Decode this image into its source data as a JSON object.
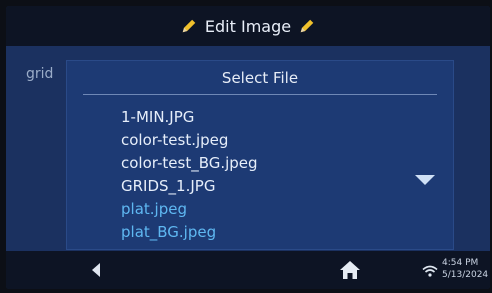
{
  "header": {
    "title": "Edit Image"
  },
  "background": {
    "label": "grid"
  },
  "dialog": {
    "title": "Select File",
    "files": [
      {
        "name": "1-MIN.JPG",
        "color": "#e6eefa"
      },
      {
        "name": "color-test.jpeg",
        "color": "#e6eefa"
      },
      {
        "name": "color-test_BG.jpeg",
        "color": "#e6eefa"
      },
      {
        "name": "GRIDS_1.JPG",
        "color": "#e6eefa"
      },
      {
        "name": "plat.jpeg",
        "color": "#5fb8f2"
      },
      {
        "name": "plat_BG.jpeg",
        "color": "#5fb8f2"
      }
    ]
  },
  "footer": {
    "time": "4:54 PM",
    "date": "5/13/2024"
  },
  "colors": {
    "accent": "#5fb8f2",
    "header_bg": "#0d1424",
    "dialog_bg": "#1d3a74"
  },
  "icons": [
    "pencil-icon",
    "chevron-down-icon",
    "back-icon",
    "home-icon",
    "wifi-icon"
  ]
}
